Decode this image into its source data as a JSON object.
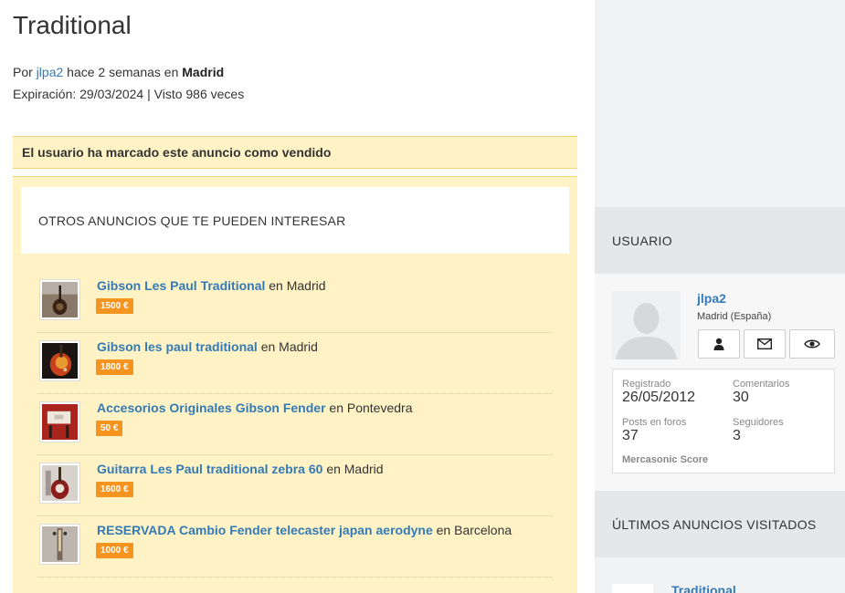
{
  "listing": {
    "title": "Traditional",
    "by_prefix": "Por",
    "author": "jlpa2",
    "time_text": "hace 2 semanas en",
    "city": "Madrid",
    "expiry_line": "Expiración: 29/03/2024 | Visto 986 veces"
  },
  "sold_notice": "El usuario ha marcado este anuncio como vendido",
  "related": {
    "heading": "OTROS ANUNCIOS QUE TE PUEDEN INTERESAR",
    "items": [
      {
        "title": "Gibson Les Paul Traditional",
        "location": "en Madrid",
        "price": "1500 €"
      },
      {
        "title": "Gibson les paul traditional",
        "location": "en Madrid",
        "price": "1800 €"
      },
      {
        "title": "Accesorios Originales Gibson Fender",
        "location": "en Pontevedra",
        "price": "50 €"
      },
      {
        "title": "Guitarra Les Paul traditional zebra 60",
        "location": "en Madrid",
        "price": "1600 €"
      },
      {
        "title": "RESERVADA Cambio Fender telecaster japan aerodyne",
        "location": "en Barcelona",
        "price": "1000 €"
      }
    ]
  },
  "sidebar": {
    "user_heading": "USUARIO",
    "user": {
      "name": "jlpa2",
      "location": "Madrid (España)",
      "buttons": [
        "user-icon",
        "envelope-icon",
        "eye-icon"
      ],
      "stats": {
        "registered_label": "Registrado",
        "registered_value": "26/05/2012",
        "comments_label": "Comentarios",
        "comments_value": "30",
        "posts_label": "Posts en foros",
        "posts_value": "37",
        "followers_label": "Seguidores",
        "followers_value": "3",
        "score_label": "Mercasonic Score"
      }
    },
    "recent_heading": "ÚLTIMOS ANUNCIOS VISITADOS",
    "recent_first": "Traditional"
  },
  "colors": {
    "link": "#337ab7",
    "price_badge": "#f5941f",
    "notice_bg": "#fff2c5"
  }
}
